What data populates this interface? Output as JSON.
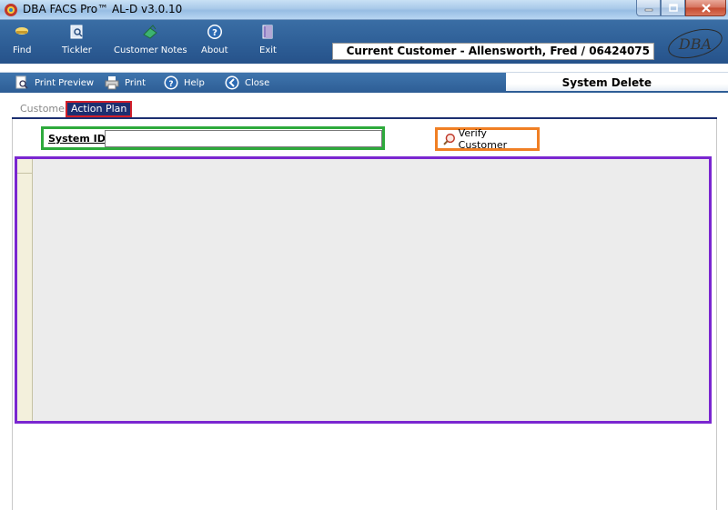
{
  "window": {
    "title": "DBA FACS Pro™ AL-D v3.0.10",
    "controls": [
      "minimize",
      "maximize",
      "close"
    ]
  },
  "toolbar": {
    "items": [
      {
        "label": "Find",
        "icon": "find-icon"
      },
      {
        "label": "Tickler",
        "icon": "tickler-icon"
      },
      {
        "label": "Customer Notes",
        "icon": "notes-icon"
      },
      {
        "label": "About",
        "icon": "help-icon"
      },
      {
        "label": "Exit",
        "icon": "exit-icon"
      }
    ],
    "current_customer": "Current Customer - Allensworth, Fred / 06424075",
    "logo_text": "DBA"
  },
  "toolbar2": {
    "items": [
      {
        "label": "Print Preview",
        "icon": "print-preview-icon"
      },
      {
        "label": "Print",
        "icon": "printer-icon"
      },
      {
        "label": "Help",
        "icon": "help-icon"
      },
      {
        "label": "Close",
        "icon": "back-arrow-icon"
      }
    ],
    "section_title": "System Delete"
  },
  "tabs": [
    {
      "label": "Customer",
      "active": false
    },
    {
      "label": "Action Plan",
      "active": true
    }
  ],
  "form": {
    "system_id_label": "System ID",
    "system_id_value": "",
    "verify_button_label": "Verify Customer"
  },
  "colors": {
    "toolbar": "#2d5d95",
    "tab_active_bg": "#1c2f70",
    "highlight_red": "#d21f2a",
    "highlight_green": "#2eaa3c",
    "highlight_orange": "#f07f24",
    "highlight_purple": "#7a26d0"
  }
}
